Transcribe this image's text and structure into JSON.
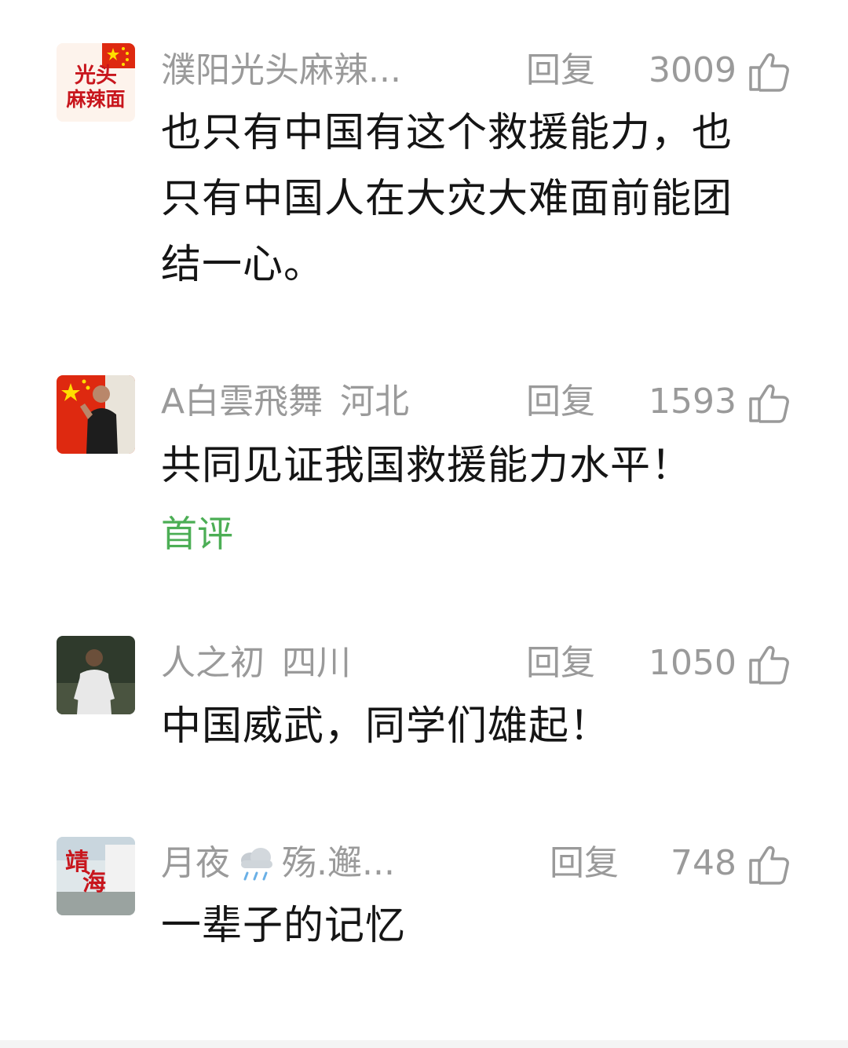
{
  "comments": [
    {
      "username": "濮阳光头麻辣...",
      "region": "",
      "reply_label": "回复",
      "likes": "3009",
      "text_lines": [
        "也只有中国有这个救援能力，也",
        "只有中国人在大灾大难面前能团",
        "结一心。"
      ],
      "avatar_text": [
        "光头",
        "麻辣面"
      ]
    },
    {
      "username": "A白雲飛舞",
      "region": "河北",
      "reply_label": "回复",
      "likes": "1593",
      "text_lines": [
        "共同见证我国救援能力水平！"
      ],
      "tag": "首评"
    },
    {
      "username": "人之初",
      "region": "四川",
      "reply_label": "回复",
      "likes": "1050",
      "text_lines": [
        "中国威武，同学们雄起！"
      ]
    },
    {
      "username_prefix": "月夜",
      "username_suffix": "殇.邂...",
      "reply_label": "回复",
      "likes": "748",
      "text_lines": [
        "一辈子的记忆"
      ],
      "avatar_text": [
        "靖",
        "海"
      ]
    }
  ],
  "colors": {
    "meta_gray": "#9a9a9a",
    "text_dark": "#151515",
    "tag_green": "#4cae55",
    "flag_red": "#de2910",
    "flag_yellow": "#ffde00"
  },
  "icons": {
    "like": "thumbs-up-icon",
    "weather": "rain-cloud-icon"
  }
}
